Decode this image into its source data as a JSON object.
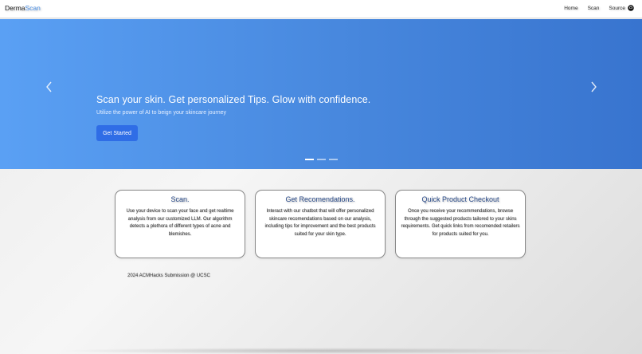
{
  "navbar": {
    "brand_main": "Derma",
    "brand_accent": "Scan",
    "links": [
      {
        "label": "Home"
      },
      {
        "label": "Scan"
      },
      {
        "label": "Source"
      }
    ],
    "source_icon": "github-icon"
  },
  "hero": {
    "title": "Scan your skin. Get personalized Tips. Glow with confidence.",
    "subtitle": "Utilize the power of AI to beign your skincare journey",
    "cta_label": "Get Started",
    "prev_icon": "chevron-left-icon",
    "next_icon": "chevron-right-icon",
    "slide_count": 3,
    "active_slide": 1,
    "gradient_start": "#5aa0f4",
    "gradient_end": "#3874cf",
    "cta_color": "#2f6de6"
  },
  "cards": [
    {
      "title": "Scan.",
      "text": "Use your device to scan your face and get realtime analysis from our customized LLM. Our algorithm detects a plethora of different types of acne and blemishes."
    },
    {
      "title": "Get Recomendations.",
      "text": "Interact with our chatbot that will offer personalized skincare recomendations based on our analysis, including tips for improvement and the best products suited for your skin type."
    },
    {
      "title": "Quick Product Checkout",
      "text": "Once you receive your recommendations, browse through the suggested products tailored to your skins requirements. Get quick links from recomended retailers for products suited for you."
    }
  ],
  "footer": {
    "text": "2024 ACMHacks Submission @ UCSC"
  }
}
